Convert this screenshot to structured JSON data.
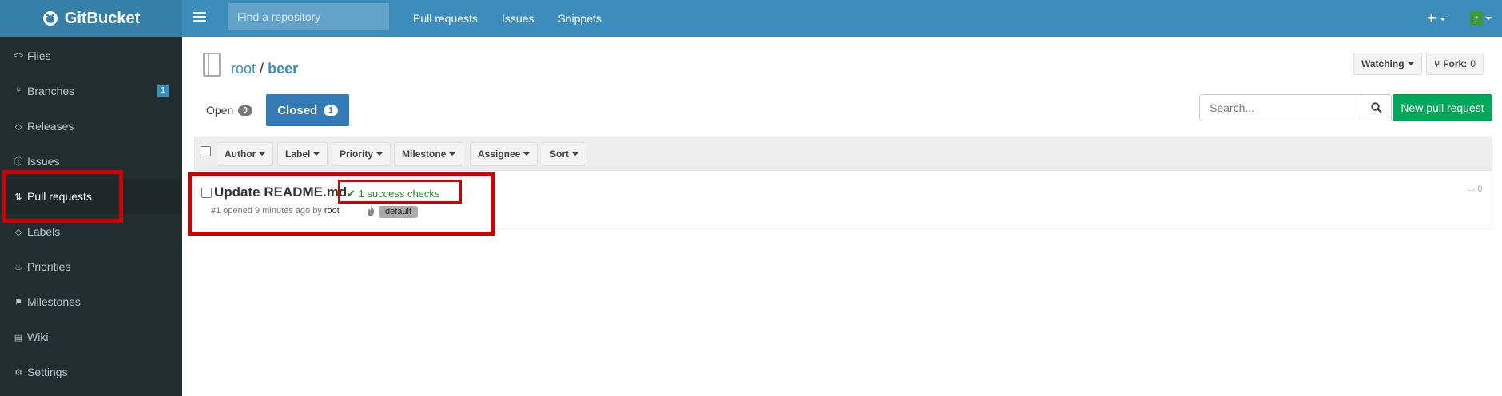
{
  "app": {
    "name": "GitBucket"
  },
  "header": {
    "search_placeholder": "Find a repository",
    "nav": [
      "Pull requests",
      "Issues",
      "Snippets"
    ],
    "plus": "+",
    "avatar_letter": "r"
  },
  "sidebar": {
    "items": [
      {
        "label": "Files",
        "icon": "code-icon"
      },
      {
        "label": "Branches",
        "icon": "branch-icon",
        "badge": "1"
      },
      {
        "label": "Releases",
        "icon": "tag-icon"
      },
      {
        "label": "Issues",
        "icon": "issue-icon"
      },
      {
        "label": "Pull requests",
        "icon": "pull-request-icon"
      },
      {
        "label": "Labels",
        "icon": "tag-icon"
      },
      {
        "label": "Priorities",
        "icon": "flame-icon"
      },
      {
        "label": "Milestones",
        "icon": "milestone-icon"
      },
      {
        "label": "Wiki",
        "icon": "wiki-icon"
      },
      {
        "label": "Settings",
        "icon": "gear-icon"
      }
    ]
  },
  "repo": {
    "owner": "root",
    "separator": "/",
    "name": "beer"
  },
  "actions": {
    "watching": "Watching",
    "fork": "Fork:",
    "fork_count": "0"
  },
  "tabs": {
    "open_label": "Open",
    "open_count": "0",
    "closed_label": "Closed",
    "closed_count": "1"
  },
  "search": {
    "placeholder": "Search..."
  },
  "new_pr": "New pull request",
  "filters": [
    "Author",
    "Label",
    "Priority",
    "Milestone",
    "Assignee",
    "Sort"
  ],
  "pull_request": {
    "title": "Update README.md",
    "status": "1 success checks",
    "meta_prefix": "#1 opened 9 minutes ago by",
    "author": "root",
    "label": "default",
    "comments": "0"
  },
  "colors": {
    "header": "#3c8dbc",
    "sidebar": "#222d32",
    "primary": "#337ab7",
    "success": "#00a65a",
    "highlight": "#cc0000"
  }
}
